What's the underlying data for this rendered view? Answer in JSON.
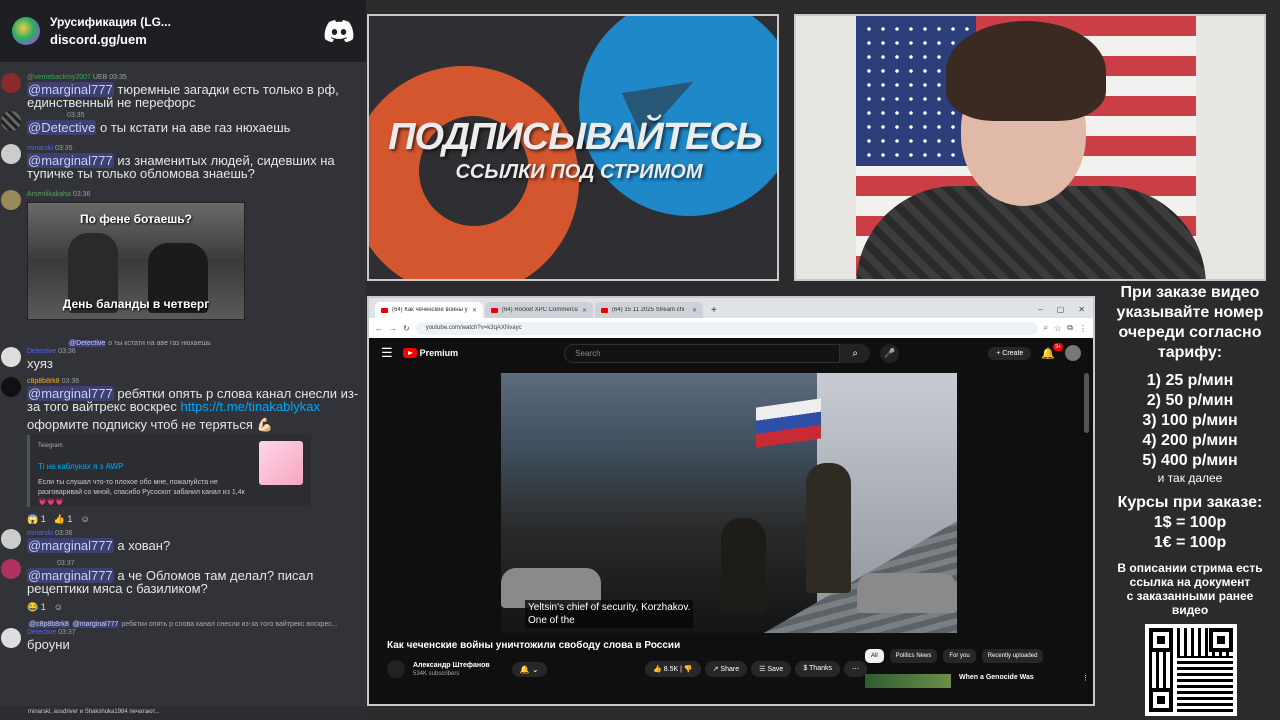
{
  "discord": {
    "server_name": "Урусификация (LG...",
    "invite": "discord.gg/uem"
  },
  "chat": {
    "messages": [
      {
        "user": "@vemebackmy2007",
        "badge": "UEB",
        "time": "03:35",
        "mention": "@marginal777",
        "text": "тюремные загадки есть только в рф, единственный не перефорс"
      },
      {
        "user": "",
        "time": "03:35",
        "mention": "@Detective",
        "text": "о ты кстати на аве газ нюхаешь"
      },
      {
        "user": "minarski",
        "time": "03:35",
        "mention": "@marginal777",
        "text": "из знаменитых людей, сидевших на тупичке ты только обломова знаешь?"
      },
      {
        "user": "Arsenlikakaha",
        "time": "03:36",
        "gif_top": "По фене ботаешь?",
        "gif_bottom": "День баланды в четверг"
      },
      {
        "reply_mention": "@Detective",
        "reply_text": "о ты кстати на аве газ нюхаешь",
        "user": "Detective",
        "time": "03:36",
        "text": "хуяз"
      },
      {
        "user": "c8p8b8rk8",
        "time": "03:36",
        "mention": "@marginal777",
        "text": "ребятки опять р слова канал снесли из-за того вайтрекс воскрес",
        "link": "https://t.me/tinakablykax",
        "text2": "оформите подписку чтоб не теряться 💪🏻",
        "embed": {
          "provider": "Telegram",
          "title": "Ti на каблуках я з AWP",
          "desc": "Если ты слушал что-то плохое обо мне, пожалуйста не разговаривай со мной, спасибо Русоскот забанил канал из 1,4к 💗💗💗"
        },
        "reactions": [
          "😱 1",
          "👍 1",
          "☺"
        ]
      },
      {
        "user": "minarski",
        "time": "03:36",
        "mention": "@marginal777",
        "text": "а хован?"
      },
      {
        "user": "",
        "time": "03:37",
        "mention": "@marginal777",
        "text": "а че Обломов там делал? писал рецептики мяса с базиликом?",
        "reactions": [
          "😂 1",
          "☺"
        ]
      },
      {
        "reply_mention": "@c8p8b8rk8",
        "reply_mention2": "@marginal777",
        "reply_text": "ребятки опять р слова канал снесли из-за того вайтрекс воскрес...",
        "user": "Detective",
        "time": "03:37",
        "text": "броуни"
      }
    ],
    "typing": "minarski, assdriver и Shakshuka1984 печатают..."
  },
  "promo": {
    "headline": "ПОДПИСЫВАЙТЕСЬ",
    "subline": "ССЫЛКИ ПОД СТРИМОМ"
  },
  "browser": {
    "tabs": [
      {
        "label": "(64) Как чеченские войны у",
        "active": true
      },
      {
        "label": "(64) Rocket XPC Commercial",
        "active": false
      },
      {
        "label": "(64) 15 11 2025 Stream chi",
        "active": false
      }
    ],
    "url": "youtube.com/watch?v=k3qAXNvayc"
  },
  "youtube": {
    "brand": "Premium",
    "search_placeholder": "Search",
    "create_label": "Create",
    "notif_count": "9+",
    "subtitle_line1": "Yeltsin's chief of security, Korzhakov.",
    "subtitle_line2": "One of the",
    "video_title": "Как чеченские войны уничтожили свободу слова в России",
    "channel_name": "Александр Штефанов",
    "channel_subs": "534K subscribers",
    "likes": "8.5K",
    "share": "Share",
    "save": "Save",
    "thanks": "Thanks",
    "chips": [
      "All",
      "Politics News",
      "For you",
      "Recently uploaded"
    ],
    "suggested_title": "When a Genocide Was"
  },
  "pricing": {
    "intro": [
      "При заказе видео",
      "указывайте номер",
      "очереди согласно",
      "тарифу:"
    ],
    "tiers": [
      "1) 25 р/мин",
      "2) 50 р/мин",
      "3) 100 р/мин",
      "4) 200 р/мин",
      "5) 400 р/мин"
    ],
    "etc": "и так далее",
    "rates_title": "Курсы при заказе:",
    "rates": [
      "1$ = 100р",
      "1€ = 100р"
    ],
    "note": [
      "В описании стрима есть",
      "ссылка на документ",
      "с заказанными ранее",
      "видео"
    ]
  }
}
